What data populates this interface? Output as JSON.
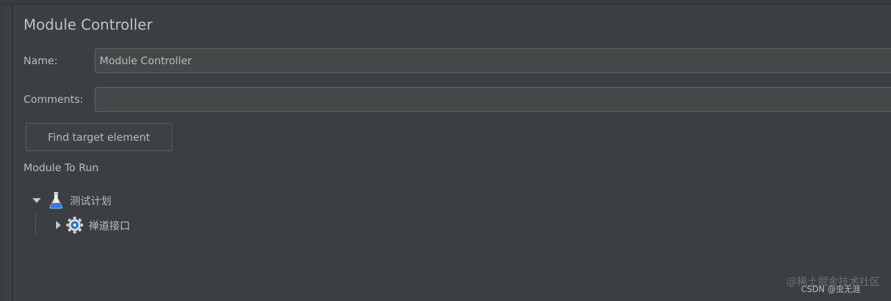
{
  "panel": {
    "title": "Module Controller"
  },
  "form": {
    "name_label": "Name:",
    "name_value": "Module Controller",
    "comments_label": "Comments:",
    "comments_value": ""
  },
  "actions": {
    "find_target_label": "Find target element"
  },
  "module_tree": {
    "section_label": "Module To Run",
    "nodes": [
      {
        "label": "测试计划",
        "icon": "test-plan-flask-icon",
        "expanded": true
      },
      {
        "label": "禅道接口",
        "icon": "gear-icon",
        "expanded": false
      }
    ]
  },
  "watermark": {
    "main": "@稀土掘金技术社区",
    "sub": "CSDN @虫无涯"
  },
  "colors": {
    "background": "#3c3f41",
    "field_background": "#45494a",
    "text": "#bbbbbb",
    "flask_blue": "#2a7de1"
  }
}
